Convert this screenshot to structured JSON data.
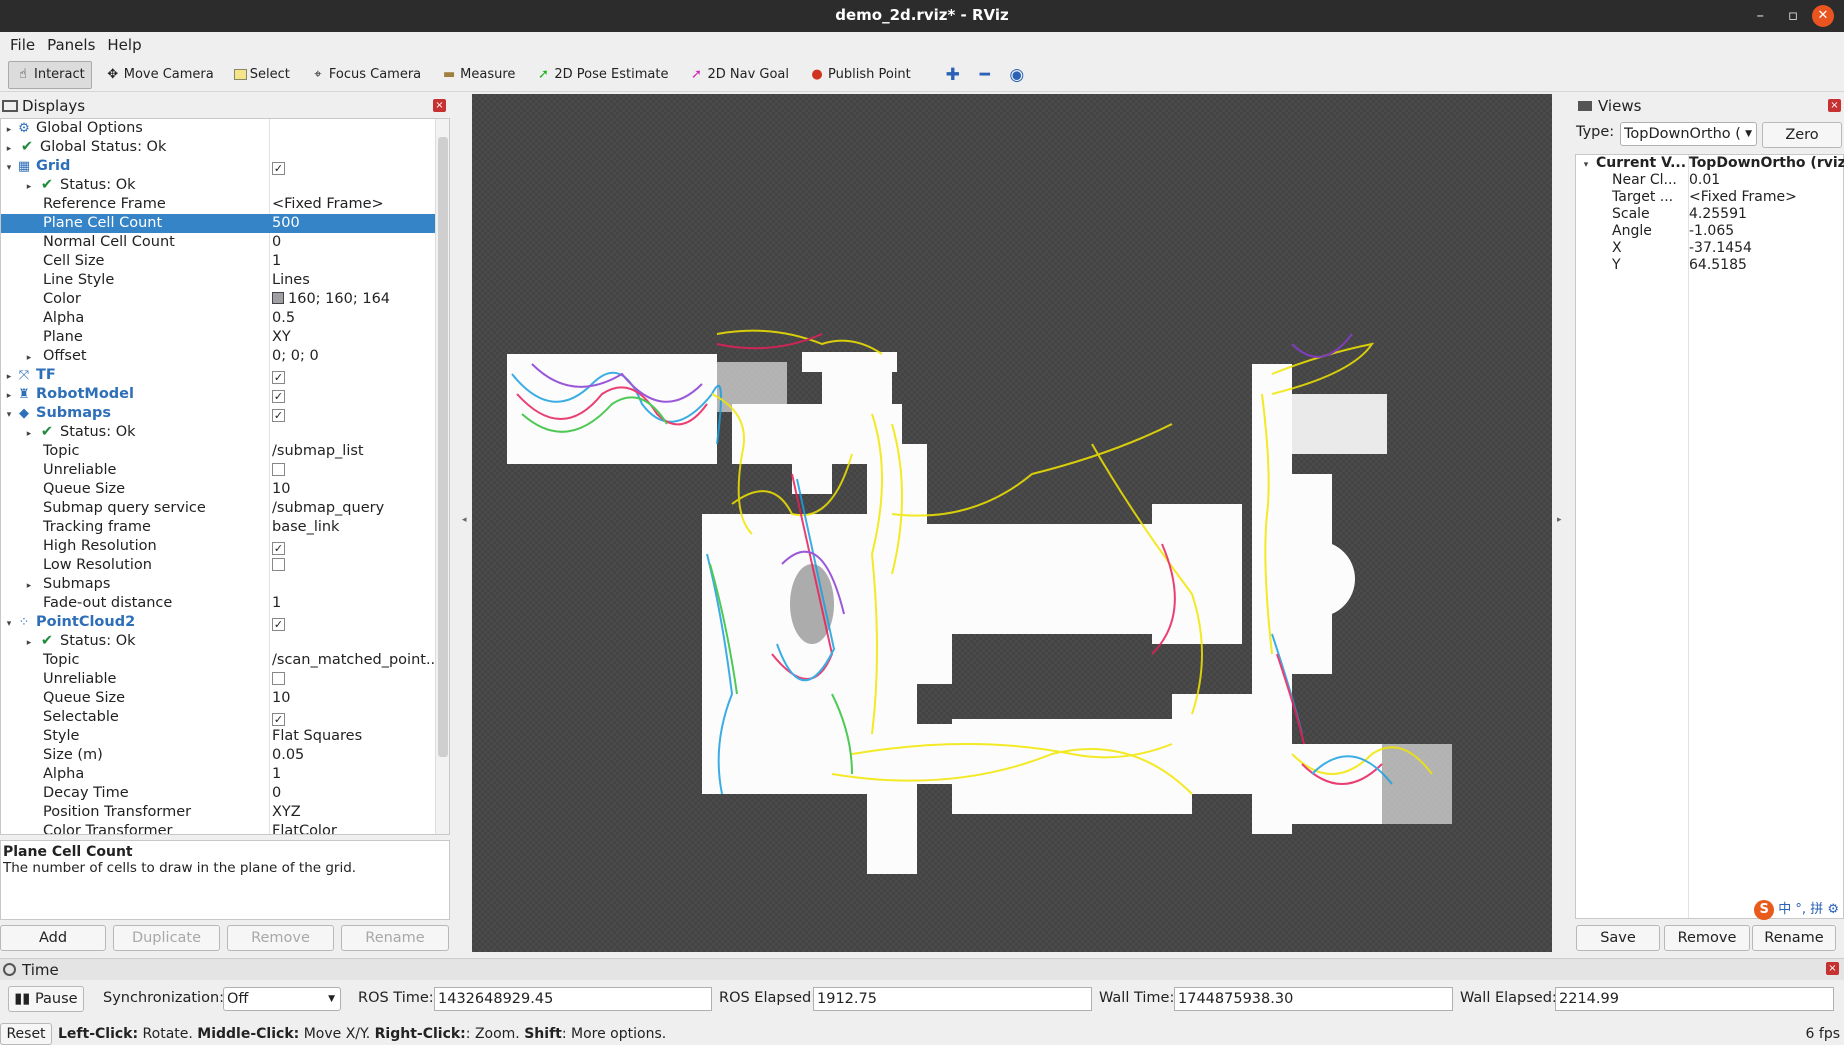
{
  "window": {
    "title": "demo_2d.rviz* - RViz",
    "minimize": "–",
    "restore": "▫",
    "close": "✕"
  },
  "menu": [
    "File",
    "Panels",
    "Help"
  ],
  "toolbar": {
    "interact": "Interact",
    "move_camera": "Move Camera",
    "select": "Select",
    "focus_camera": "Focus Camera",
    "measure": "Measure",
    "pose_estimate": "2D Pose Estimate",
    "nav_goal": "2D Nav Goal",
    "publish_point": "Publish Point"
  },
  "displays": {
    "title": "Displays",
    "rows": [
      {
        "arrow": "▸",
        "icon": "gear",
        "label": "Global Options",
        "value": "",
        "type": "plain"
      },
      {
        "arrow": "▸",
        "icon": "tick",
        "label": "Global Status: Ok",
        "value": "",
        "type": "plain"
      },
      {
        "arrow": "▾",
        "icon": "grid",
        "label": "Grid",
        "value": "",
        "type": "cat",
        "check": true
      },
      {
        "arrow": "▸",
        "icon": "tick",
        "label": "Status: Ok",
        "value": "",
        "type": "sub"
      },
      {
        "arrow": "",
        "label": "Reference Frame",
        "value": "<Fixed Frame>",
        "type": "prop"
      },
      {
        "arrow": "",
        "label": "Plane Cell Count",
        "value": "500",
        "type": "prop",
        "selected": true
      },
      {
        "arrow": "",
        "label": "Normal Cell Count",
        "value": "0",
        "type": "prop"
      },
      {
        "arrow": "",
        "label": "Cell Size",
        "value": "1",
        "type": "prop"
      },
      {
        "arrow": "",
        "label": "Line Style",
        "value": "Lines",
        "type": "prop"
      },
      {
        "arrow": "",
        "label": "Color",
        "value": "160; 160; 164",
        "type": "prop",
        "swatch": "#a0a0a4"
      },
      {
        "arrow": "",
        "label": "Alpha",
        "value": "0.5",
        "type": "prop"
      },
      {
        "arrow": "",
        "label": "Plane",
        "value": "XY",
        "type": "prop"
      },
      {
        "arrow": "▸",
        "label": "Offset",
        "value": "0; 0; 0",
        "type": "propx"
      },
      {
        "arrow": "▸",
        "icon": "tf",
        "label": "TF",
        "value": "",
        "type": "cat",
        "check": true
      },
      {
        "arrow": "▸",
        "icon": "robot",
        "label": "RobotModel",
        "value": "",
        "type": "cat",
        "check": true
      },
      {
        "arrow": "▾",
        "icon": "diamond",
        "label": "Submaps",
        "value": "",
        "type": "cat",
        "check": true
      },
      {
        "arrow": "▸",
        "icon": "tick",
        "label": "Status: Ok",
        "value": "",
        "type": "sub"
      },
      {
        "arrow": "",
        "label": "Topic",
        "value": "/submap_list",
        "type": "prop"
      },
      {
        "arrow": "",
        "label": "Unreliable",
        "value": "",
        "type": "prop",
        "check": false
      },
      {
        "arrow": "",
        "label": "Queue Size",
        "value": "10",
        "type": "prop"
      },
      {
        "arrow": "",
        "label": "Submap query service",
        "value": "/submap_query",
        "type": "prop"
      },
      {
        "arrow": "",
        "label": "Tracking frame",
        "value": "base_link",
        "type": "prop"
      },
      {
        "arrow": "",
        "label": "High Resolution",
        "value": "",
        "type": "prop",
        "check": true
      },
      {
        "arrow": "",
        "label": "Low Resolution",
        "value": "",
        "type": "prop",
        "check": false
      },
      {
        "arrow": "▸",
        "label": "Submaps",
        "value": "",
        "type": "propx"
      },
      {
        "arrow": "",
        "label": "Fade-out distance",
        "value": "1",
        "type": "prop"
      },
      {
        "arrow": "▾",
        "icon": "cloud",
        "label": "PointCloud2",
        "value": "",
        "type": "cat",
        "check": true
      },
      {
        "arrow": "▸",
        "icon": "tick",
        "label": "Status: Ok",
        "value": "",
        "type": "sub"
      },
      {
        "arrow": "",
        "label": "Topic",
        "value": "/scan_matched_point...",
        "type": "prop"
      },
      {
        "arrow": "",
        "label": "Unreliable",
        "value": "",
        "type": "prop",
        "check": false
      },
      {
        "arrow": "",
        "label": "Queue Size",
        "value": "10",
        "type": "prop"
      },
      {
        "arrow": "",
        "label": "Selectable",
        "value": "",
        "type": "prop",
        "check": true
      },
      {
        "arrow": "",
        "label": "Style",
        "value": "Flat Squares",
        "type": "prop"
      },
      {
        "arrow": "",
        "label": "Size (m)",
        "value": "0.05",
        "type": "prop"
      },
      {
        "arrow": "",
        "label": "Alpha",
        "value": "1",
        "type": "prop"
      },
      {
        "arrow": "",
        "label": "Decay Time",
        "value": "0",
        "type": "prop"
      },
      {
        "arrow": "",
        "label": "Position Transformer",
        "value": "XYZ",
        "type": "prop"
      },
      {
        "arrow": "",
        "label": "Color Transformer",
        "value": "FlatColor",
        "type": "prop"
      }
    ],
    "desc_title": "Plane Cell Count",
    "desc_text": "The number of cells to draw in the plane of the grid.",
    "buttons": {
      "add": "Add",
      "duplicate": "Duplicate",
      "remove": "Remove",
      "rename": "Rename"
    }
  },
  "views": {
    "title": "Views",
    "type_label": "Type:",
    "type_value": "TopDownOrtho (",
    "zero": "Zero",
    "current_label": "Current V...",
    "current_value": "TopDownOrtho (rviz)",
    "props": [
      {
        "label": "Near Cl...",
        "value": "0.01"
      },
      {
        "label": "Target ...",
        "value": "<Fixed Frame>"
      },
      {
        "label": "Scale",
        "value": "4.25591"
      },
      {
        "label": "Angle",
        "value": "-1.065"
      },
      {
        "label": "X",
        "value": "-37.1454"
      },
      {
        "label": "Y",
        "value": "64.5185"
      }
    ],
    "ime": "中 °, 拼",
    "buttons": {
      "save": "Save",
      "remove": "Remove",
      "rename": "Rename"
    }
  },
  "time": {
    "title": "Time",
    "pause": "Pause",
    "sync_label": "Synchronization:",
    "sync_value": "Off",
    "ros_time_label": "ROS Time:",
    "ros_time": "1432648929.45",
    "ros_elapsed_label": "ROS Elapsed:",
    "ros_elapsed": "1912.75",
    "wall_time_label": "Wall Time:",
    "wall_time": "1744875938.30",
    "wall_elapsed_label": "Wall Elapsed:",
    "wall_elapsed": "2214.99"
  },
  "status": {
    "reset": "Reset",
    "k1": "Left-Click:",
    "t1": " Rotate. ",
    "k2": "Middle-Click:",
    "t2": " Move X/Y. ",
    "k3": "Right-Click:",
    "t3": ": Zoom. ",
    "k4": "Shift",
    "t4": ": More options.",
    "fps": "6 fps"
  },
  "colors": {
    "accent": "#3584c8",
    "category": "#2e6fb8",
    "viewport_bg": "#474747",
    "close": "#e95420"
  }
}
